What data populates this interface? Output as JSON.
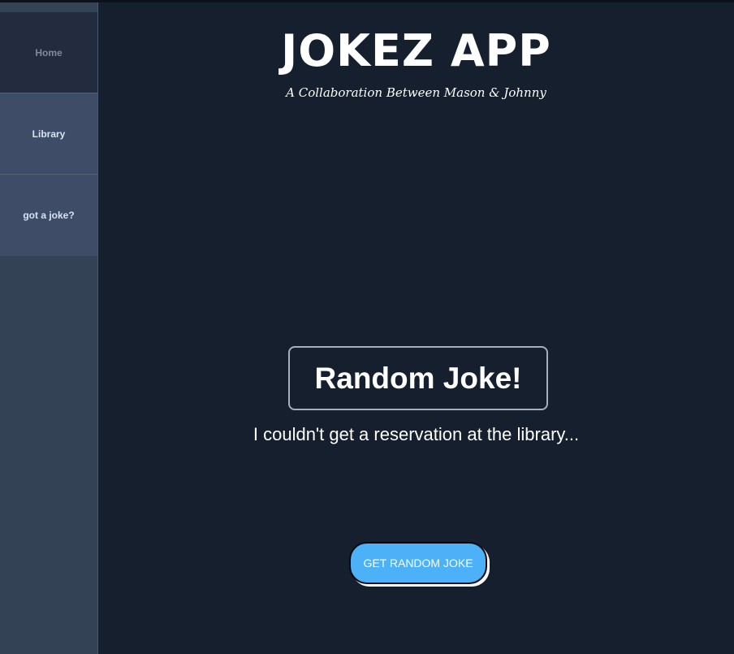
{
  "sidebar": {
    "items": [
      {
        "label": "Home"
      },
      {
        "label": "Library"
      },
      {
        "label": "got a joke?"
      }
    ]
  },
  "header": {
    "title": "JOKEZ APP",
    "subtitle": "A Collaboration Between Mason & Johnny"
  },
  "main": {
    "joke_heading": "Random Joke!",
    "joke_text": "I couldn't get a reservation at the library...",
    "button_label": "GET RANDOM JOKE"
  },
  "colors": {
    "background": "#151f2d",
    "sidebar": "#334255",
    "nav_active": "#232c3e",
    "nav_item": "#3e4c68",
    "button": "#4db1f7"
  }
}
